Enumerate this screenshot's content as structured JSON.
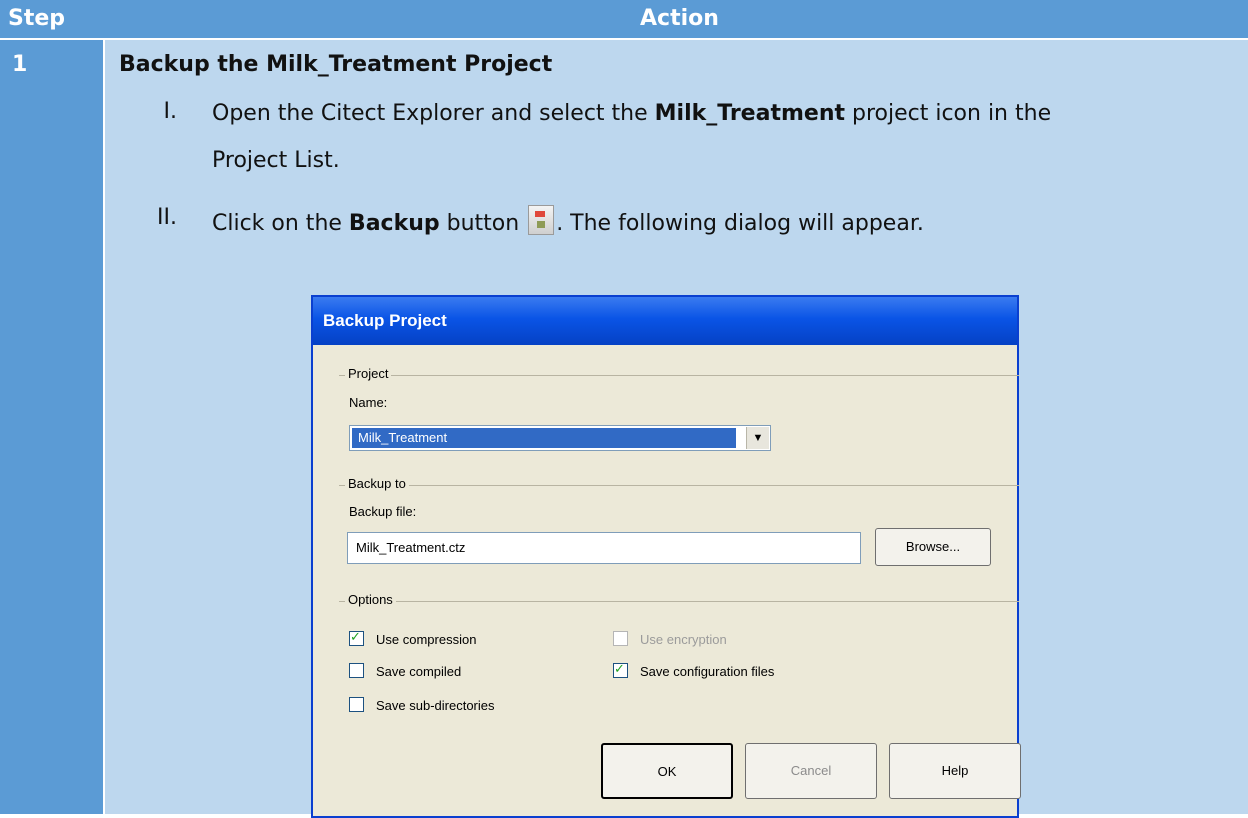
{
  "header": {
    "col_step": "Step",
    "col_action": "Action"
  },
  "step": {
    "number": "1",
    "title": "Backup the Milk_Treatment Project",
    "items": [
      {
        "numeral": "I.",
        "line1_pre": "Open the Citect Explorer and select the ",
        "line1_bold": "Milk_Treatment",
        "line1_post": " project icon in the",
        "line2": "Project List."
      },
      {
        "numeral": "II.",
        "pre": "Click on the ",
        "bold": "Backup",
        "mid": " button ",
        "post": ". The following dialog will appear."
      }
    ]
  },
  "dialog": {
    "title": "Backup Project",
    "project_group": "Project",
    "name_label": "Name:",
    "name_value": "Milk_Treatment",
    "backup_group": "Backup to",
    "file_label": "Backup file:",
    "file_value": "Milk_Treatment.ctz",
    "browse_label": "Browse...",
    "options_group": "Options",
    "options": [
      {
        "label": "Use compression",
        "checked": true,
        "disabled": false
      },
      {
        "label": "Use encryption",
        "checked": false,
        "disabled": true
      },
      {
        "label": "Save compiled",
        "checked": false,
        "disabled": false
      },
      {
        "label": "Save configuration files",
        "checked": true,
        "disabled": false
      },
      {
        "label": "Save sub-directories",
        "checked": false,
        "disabled": false
      }
    ],
    "ok_label": "OK",
    "cancel_label": "Cancel",
    "help_label": "Help"
  }
}
